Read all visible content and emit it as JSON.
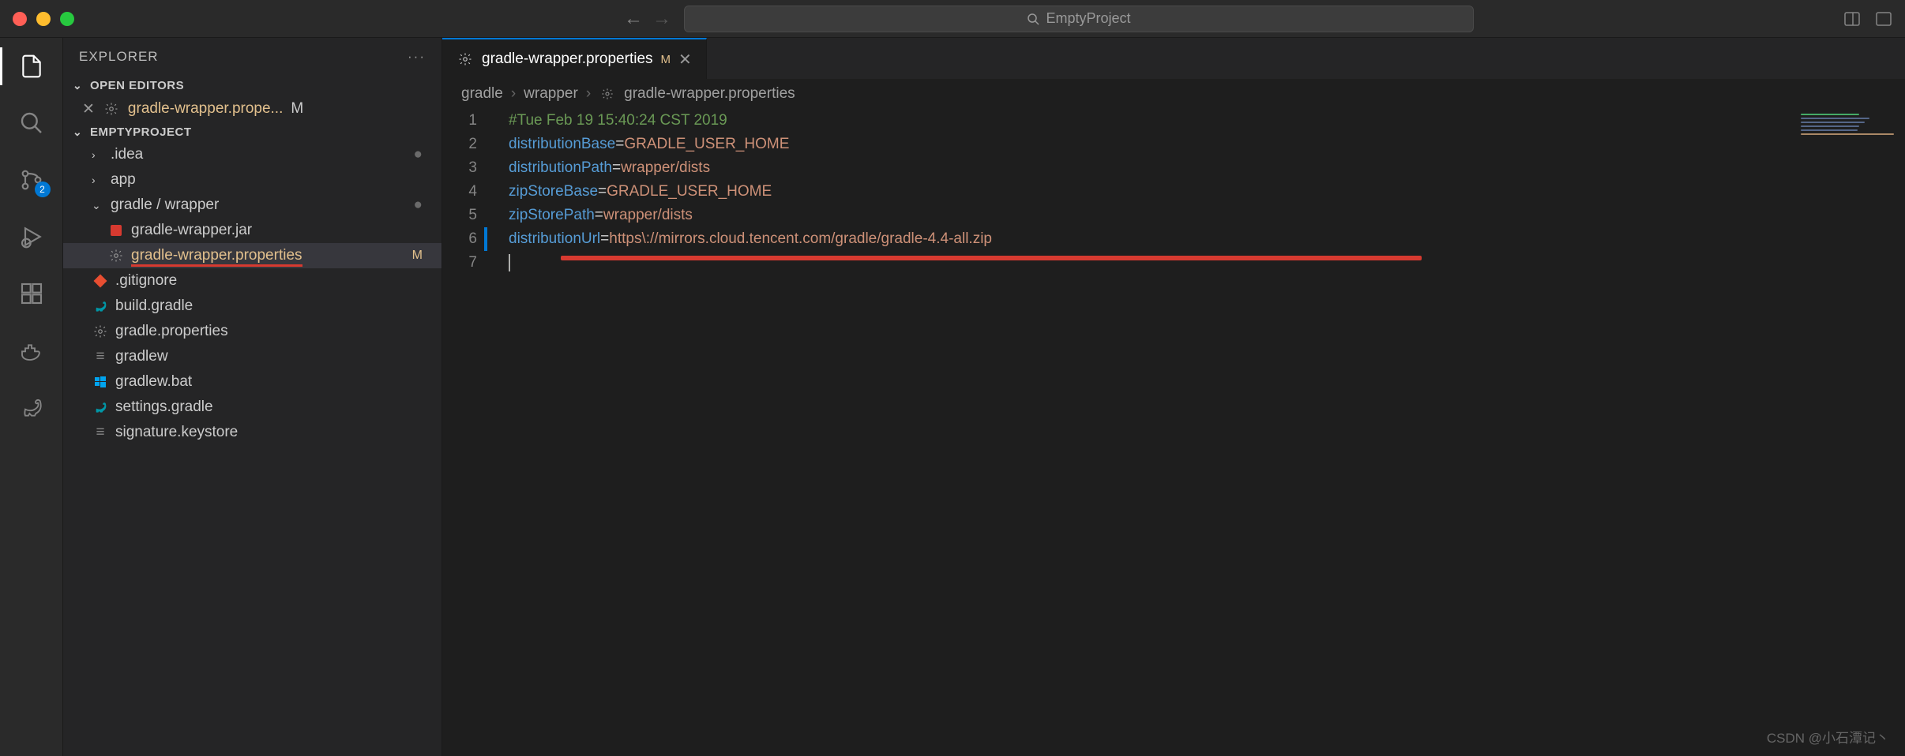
{
  "titlebar": {
    "project_name": "EmptyProject"
  },
  "activity_bar": {
    "scm_badge": "2"
  },
  "sidebar": {
    "title": "EXPLORER",
    "open_editors_label": "OPEN EDITORS",
    "open_editor": {
      "filename": "gradle-wrapper.prope...",
      "status": "M"
    },
    "project_section_label": "EMPTYPROJECT",
    "tree": {
      "idea": ".idea",
      "app": "app",
      "gradle": "gradle",
      "wrapper": "wrapper",
      "jar": "gradle-wrapper.jar",
      "props": "gradle-wrapper.properties",
      "props_status": "M",
      "gitignore": ".gitignore",
      "build_gradle": "build.gradle",
      "gradle_props": "gradle.properties",
      "gradlew": "gradlew",
      "gradlew_bat": "gradlew.bat",
      "settings_gradle": "settings.gradle",
      "signature": "signature.keystore"
    }
  },
  "tab": {
    "filename": "gradle-wrapper.properties",
    "status": "M"
  },
  "breadcrumbs": {
    "seg1": "gradle",
    "seg2": "wrapper",
    "seg3": "gradle-wrapper.properties"
  },
  "code": {
    "l1_comment": "#Tue Feb 19 15:40:24 CST 2019",
    "l2_key": "distributionBase",
    "l2_val": "GRADLE_USER_HOME",
    "l3_key": "distributionPath",
    "l3_val": "wrapper/dists",
    "l4_key": "zipStoreBase",
    "l4_val": "GRADLE_USER_HOME",
    "l5_key": "zipStorePath",
    "l5_val": "wrapper/dists",
    "l6_key": "distributionUrl",
    "l6_val": "https\\://mirrors.cloud.tencent.com/gradle/gradle-4.4-all.zip"
  },
  "line_numbers": [
    "1",
    "2",
    "3",
    "4",
    "5",
    "6",
    "7"
  ],
  "watermark": "CSDN @小石潭记丶"
}
